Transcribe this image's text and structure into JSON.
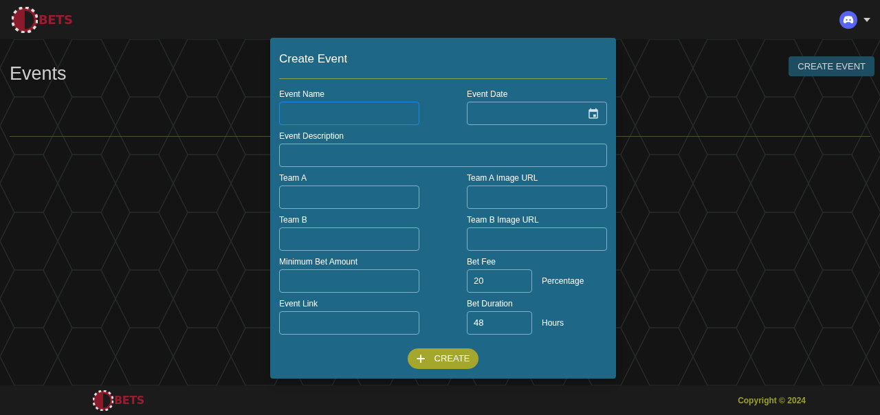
{
  "header": {
    "logo_text": "BETS"
  },
  "page": {
    "title": "Events",
    "create_button": "CREATE EVENT"
  },
  "dialog": {
    "title": "Create Event",
    "fields": [
      {
        "kind": "text",
        "label": "Event Name",
        "focused": true
      },
      {
        "kind": "date",
        "label": "Event Date",
        "focused": false
      },
      {
        "kind": "wide",
        "label": "Event Description",
        "focused": false
      },
      {
        "kind": "text",
        "label": "Team A",
        "focused": false
      },
      {
        "kind": "text",
        "label": "Team A Image URL",
        "focused": false
      },
      {
        "kind": "text",
        "label": "Team B",
        "focused": false
      },
      {
        "kind": "text",
        "label": "Team B Image URL",
        "focused": false
      },
      {
        "kind": "text",
        "label": "Minimum Bet Amount",
        "focused": false
      },
      {
        "kind": "unit",
        "label": "Bet Fee",
        "value": "20",
        "unit": "Percentage",
        "focused": false
      },
      {
        "kind": "text",
        "label": "Event Link",
        "focused": false
      },
      {
        "kind": "unit",
        "label": "Bet Duration",
        "value": "48",
        "unit": "Hours",
        "focused": false
      }
    ],
    "submit": "CREATE"
  },
  "footer": {
    "logo_text": "BETS",
    "copyright": "Copyright © 2024"
  }
}
